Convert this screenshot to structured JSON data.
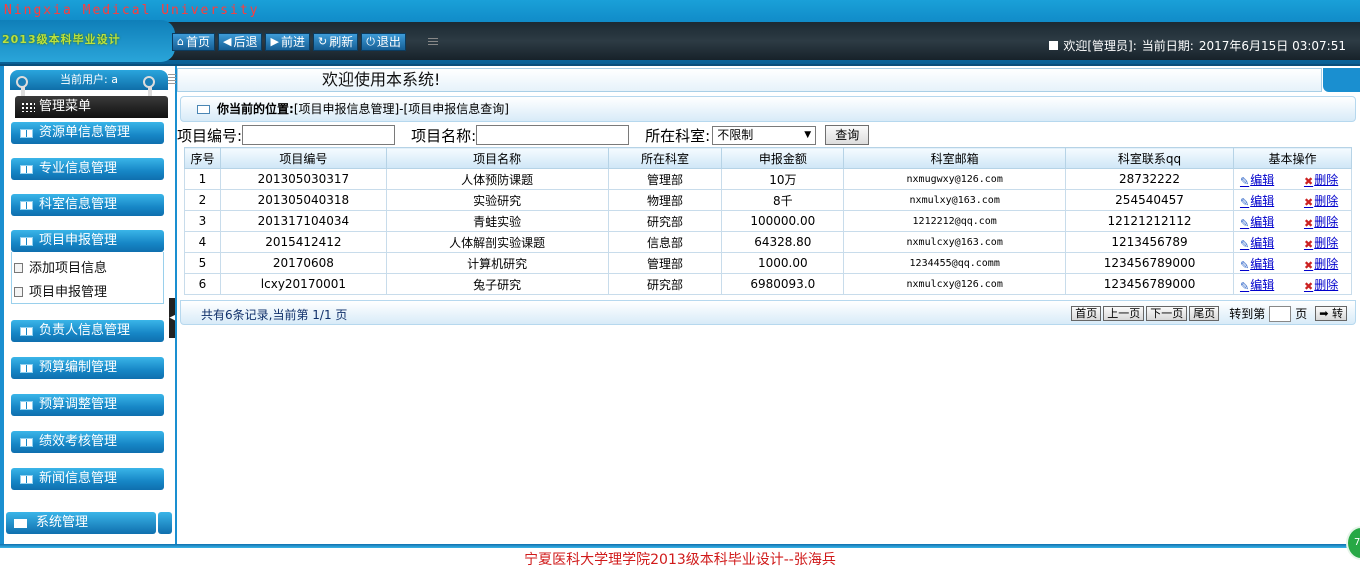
{
  "header": {
    "brand": "Ningxia Medical University",
    "subtitle": "2013级本科毕业设计",
    "nav": [
      {
        "icon": "home-icon",
        "glyph": "⌂",
        "label": "首页"
      },
      {
        "icon": "back-icon",
        "glyph": "◀",
        "label": "后退"
      },
      {
        "icon": "forward-icon",
        "glyph": "▶",
        "label": "前进"
      },
      {
        "icon": "refresh-icon",
        "glyph": "↻",
        "label": "刷新"
      },
      {
        "icon": "logout-icon",
        "glyph": "⏻",
        "label": "退出"
      }
    ],
    "welcome": "欢迎[管理员]:",
    "date_label": "当前日期:",
    "date_value": "2017年6月15日 03:07:51"
  },
  "sidebar": {
    "current_user": "当前用户: a",
    "menu_header": "管理菜单",
    "items": [
      {
        "label": "资源单信息管理"
      },
      {
        "label": "专业信息管理"
      },
      {
        "label": "科室信息管理"
      },
      {
        "label": "项目申报管理"
      },
      {
        "label": "负责人信息管理"
      },
      {
        "label": "预算编制管理"
      },
      {
        "label": "预算调整管理"
      },
      {
        "label": "绩效考核管理"
      },
      {
        "label": "新闻信息管理"
      }
    ],
    "subitems": [
      {
        "label": "添加项目信息"
      },
      {
        "label": "项目申报管理"
      }
    ],
    "system": "系统管理"
  },
  "main": {
    "welcome": "欢迎使用本系统!",
    "location_label": "你当前的位置:",
    "location_path": "[项目申报信息管理]-[项目申报信息查询]",
    "search": {
      "code_label": "项目编号:",
      "name_label": "项目名称:",
      "dept_label": "所在科室:",
      "dept_value": "不限制",
      "query_label": "查询"
    },
    "table": {
      "headers": [
        "序号",
        "项目编号",
        "项目名称",
        "所在科室",
        "申报金额",
        "科室邮箱",
        "科室联系qq",
        "基本操作"
      ],
      "rows": [
        [
          "1",
          "201305030317",
          "人体预防课题",
          "管理部",
          "10万",
          "nxmugwxy@126.com",
          "28732222"
        ],
        [
          "2",
          "201305040318",
          "实验研究",
          "物理部",
          "8千",
          "nxmulxy@163.com",
          "254540457"
        ],
        [
          "3",
          "201317104034",
          "青蛙实验",
          "研究部",
          "100000.00",
          "1212212@qq.com",
          "12121212112"
        ],
        [
          "4",
          "2015412412",
          "人体解剖实验课题",
          "信息部",
          "64328.80",
          "nxmulcxy@163.com",
          "1213456789"
        ],
        [
          "5",
          "20170608",
          "计算机研究",
          "管理部",
          "1000.00",
          "1234455@qq.comm",
          "123456789000"
        ],
        [
          "6",
          "lcxy20170001",
          "兔子研究",
          "研究部",
          "6980093.0",
          "nxmulcxy@126.com",
          "123456789000"
        ]
      ],
      "edit_label": "编辑",
      "delete_label": "删除"
    },
    "pager": {
      "info": "共有6条记录,当前第 1/1 页",
      "first": "首页",
      "prev": "上一页",
      "next": "下一页",
      "last": "尾页",
      "goto_label": "转到第",
      "page_unit": "页",
      "go": "转"
    }
  },
  "footer": {
    "text": "宁夏医科大学理学院2013级本科毕业设计--张海兵"
  }
}
